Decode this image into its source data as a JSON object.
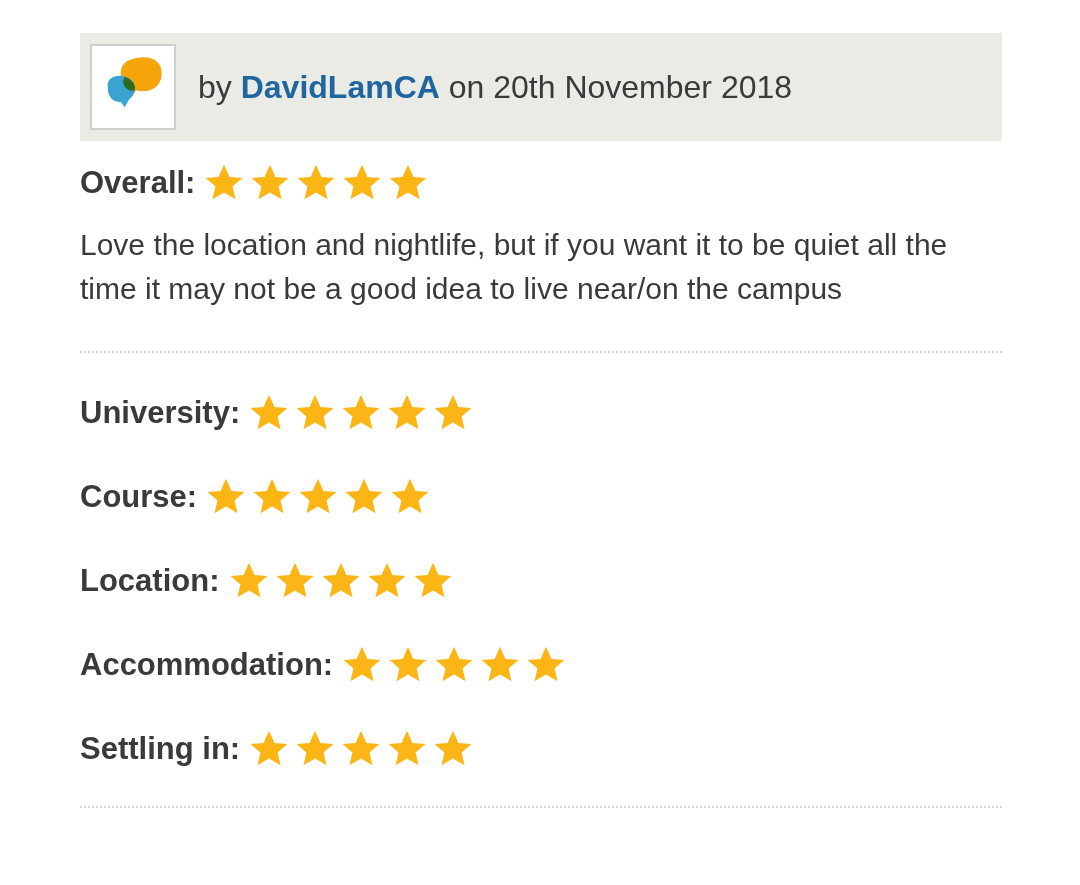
{
  "review": {
    "byline": "by **DavidLamCA** on 20th November 2018",
    "overall": {
      "label": "Overall:",
      "stars": 5
    },
    "text": "Love the location and nightlife, but if you want it to be quiet all the time it may not be a good idea to live near/on the campus",
    "ratings": [
      {
        "label": "University:",
        "stars": 5
      },
      {
        "label": "Course:",
        "stars": 5
      },
      {
        "label": "Location:",
        "stars": 5
      },
      {
        "label": "Accommodation:",
        "stars": 5
      },
      {
        "label": "Settling in:",
        "stars": 5
      }
    ]
  }
}
